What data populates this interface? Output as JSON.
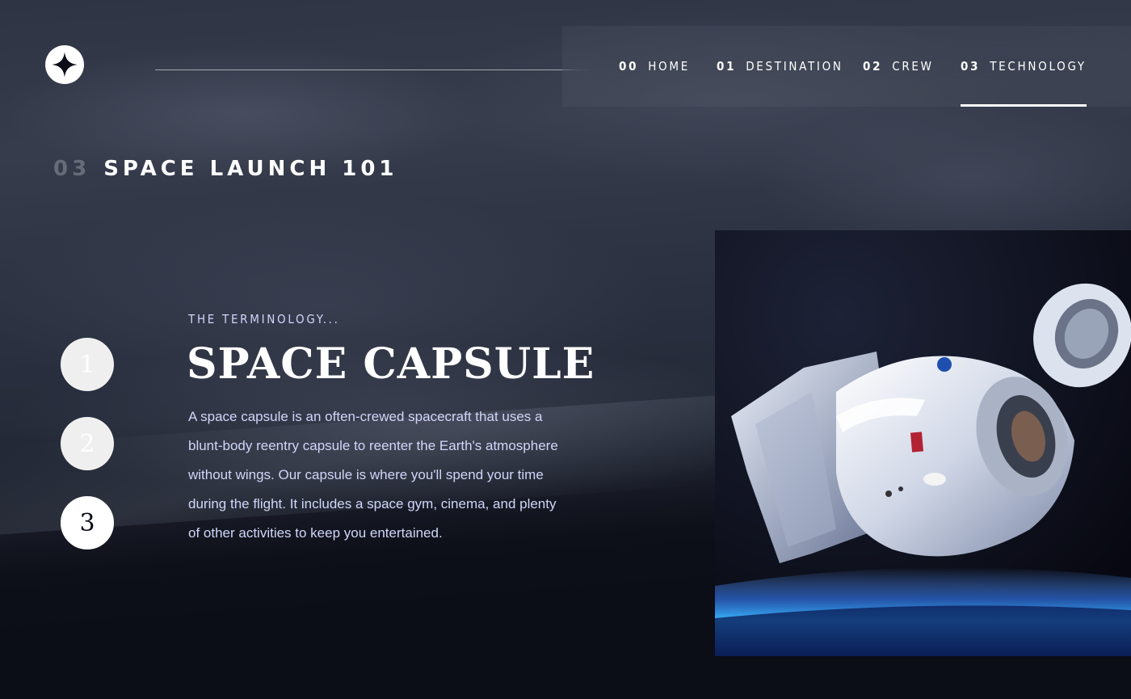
{
  "nav": {
    "items": [
      {
        "num": "00",
        "label": "HOME"
      },
      {
        "num": "01",
        "label": "DESTINATION"
      },
      {
        "num": "02",
        "label": "CREW"
      },
      {
        "num": "03",
        "label": "TECHNOLOGY"
      }
    ],
    "active_index": 3
  },
  "page": {
    "heading_num": "03",
    "heading": "SPACE LAUNCH 101"
  },
  "steps": [
    "1",
    "2",
    "3"
  ],
  "active_step": "3",
  "content": {
    "eyebrow": "THE TERMINOLOGY...",
    "title": "SPACE CAPSULE",
    "description": "A space capsule is an often-crewed spacecraft that uses a blunt-body reentry capsule to reenter the Earth's atmosphere without wings. Our capsule is where you'll spend your time during the flight. It includes a space gym, cinema, and plenty of other activities to keep you entertained."
  },
  "colors": {
    "background": "#0b0d17",
    "accent_text": "#d0d6f9",
    "white": "#ffffff"
  },
  "icons": {
    "logo": "four-point-star-icon"
  }
}
